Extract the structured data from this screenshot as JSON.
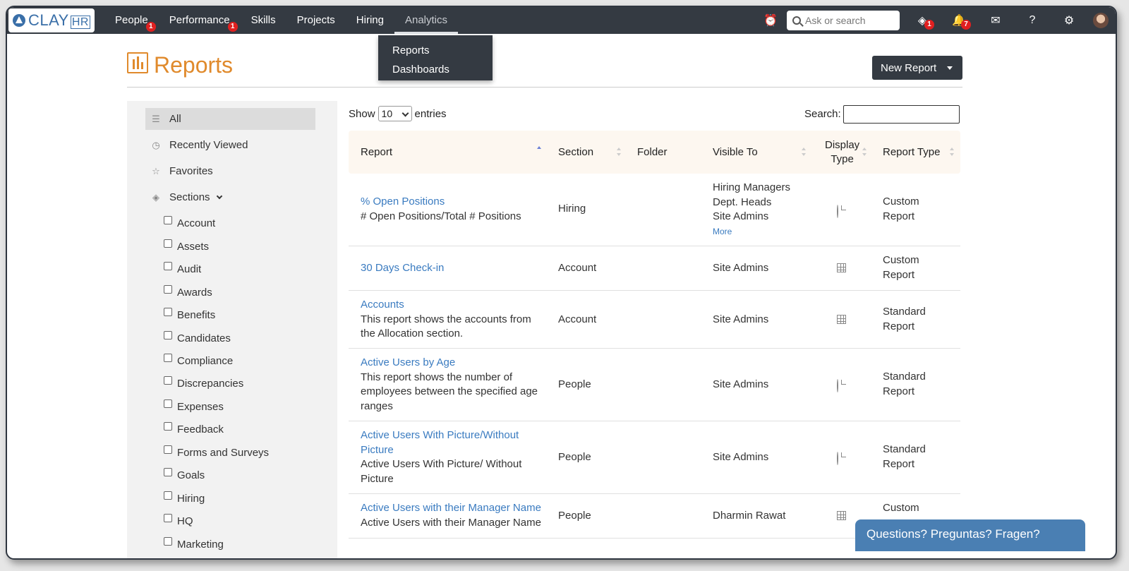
{
  "logo": {
    "text": "CLAY",
    "suffix": "HR"
  },
  "nav": {
    "items": [
      {
        "label": "People",
        "badge": "1"
      },
      {
        "label": "Performance",
        "badge": "1"
      },
      {
        "label": "Skills",
        "badge": ""
      },
      {
        "label": "Projects",
        "badge": ""
      },
      {
        "label": "Hiring",
        "badge": ""
      },
      {
        "label": "Analytics",
        "badge": ""
      }
    ],
    "search_placeholder": "Ask or search",
    "layers_badge": "1",
    "bell_badge": "7"
  },
  "analytics_menu": [
    "Reports",
    "Dashboards"
  ],
  "page": {
    "title": "Reports",
    "new_report": "New Report"
  },
  "sidebar": {
    "all": "All",
    "recent": "Recently Viewed",
    "favorites": "Favorites",
    "sections": "Sections",
    "section_items": [
      "Account",
      "Assets",
      "Audit",
      "Awards",
      "Benefits",
      "Candidates",
      "Compliance",
      "Discrepancies",
      "Expenses",
      "Feedback",
      "Forms and Surveys",
      "Goals",
      "Hiring",
      "HQ",
      "Marketing"
    ]
  },
  "table_controls": {
    "show": "Show",
    "entries_value": "10",
    "entries": "entries",
    "search": "Search:"
  },
  "table": {
    "headers": {
      "report": "Report",
      "section": "Section",
      "folder": "Folder",
      "visible": "Visible To",
      "display1": "Display",
      "display2": "Type",
      "rtype": "Report Type"
    },
    "rows": [
      {
        "name": "% Open Positions",
        "desc1": "# Open Positions/Total # Positions",
        "desc2": "",
        "desc3": "",
        "section": "Hiring",
        "visible1": "Hiring Managers",
        "visible2": "Dept. Heads",
        "visible3": "Site Admins",
        "more": "More",
        "display": "pie",
        "type1": "Custom",
        "type2": "Report"
      },
      {
        "name": "30 Days Check-in",
        "name2": "",
        "desc1": "",
        "desc2": "",
        "desc3": "",
        "section": "Account",
        "visible1": "Site Admins",
        "display": "table",
        "type1": "Custom",
        "type2": "Report"
      },
      {
        "name": "Accounts",
        "name2": "",
        "desc1": "This report shows the accounts from",
        "desc2": "the Allocation section.",
        "desc3": "",
        "section": "Account",
        "visible1": "Site Admins",
        "display": "table",
        "type1": "Standard",
        "type2": "Report"
      },
      {
        "name": "Active Users by Age",
        "name2": "",
        "desc1": "This report shows the number of",
        "desc2": "employees between the specified age",
        "desc3": "ranges",
        "section": "People",
        "visible1": "Site Admins",
        "display": "pie",
        "type1": "Standard",
        "type2": "Report"
      },
      {
        "name": "Active Users With Picture/Without",
        "name2": "Picture",
        "desc1": "Active Users With Picture/ Without",
        "desc2": "Picture",
        "desc3": "",
        "section": "People",
        "visible1": "Site Admins",
        "display": "pie",
        "type1": "Standard",
        "type2": "Report"
      },
      {
        "name": "Active Users with their Manager Name",
        "name2": "",
        "desc1": "Active Users with their Manager Name",
        "desc2": "",
        "desc3": "",
        "section": "People",
        "visible1": "Dharmin Rawat",
        "display": "table",
        "type1": "Custom",
        "type2": ""
      }
    ]
  },
  "help": "Questions? Preguntas? Fragen?"
}
